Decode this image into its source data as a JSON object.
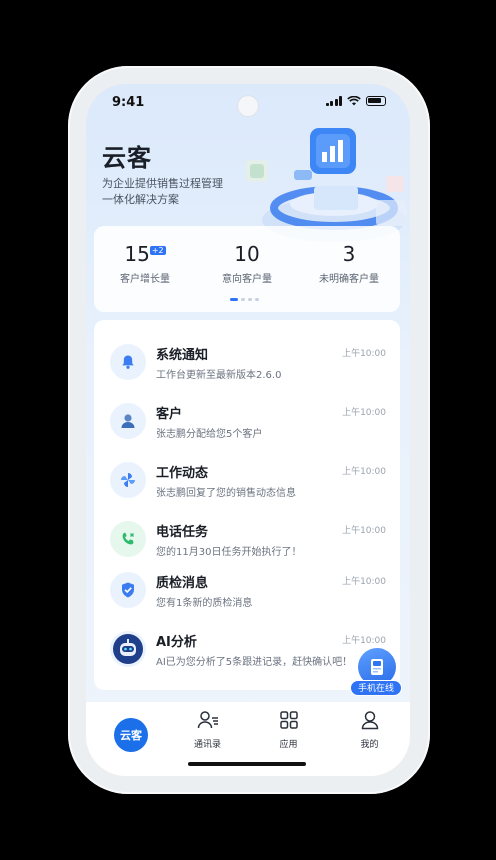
{
  "status_bar": {
    "time": "9:41"
  },
  "header": {
    "title": "云客",
    "subtitle_line1": "为企业提供销售过程管理",
    "subtitle_line2": "一体化解决方案"
  },
  "stats": [
    {
      "value": "15",
      "badge": "+2",
      "label": "客户增长量"
    },
    {
      "value": "10",
      "badge": "",
      "label": "意向客户量"
    },
    {
      "value": "3",
      "badge": "",
      "label": "未明确客户量"
    }
  ],
  "carousel": {
    "page_count": 4,
    "active_index": 0
  },
  "messages": [
    {
      "icon": "bell-icon",
      "title": "系统通知",
      "desc": "工作台更新至最新版本2.6.0",
      "time": "上午10:00"
    },
    {
      "icon": "user-icon",
      "title": "客户",
      "desc": "张志鹏分配给您5个客户",
      "time": "上午10:00"
    },
    {
      "icon": "pinwheel-icon",
      "title": "工作动态",
      "desc": "张志鹏回复了您的销售动态信息",
      "time": "上午10:00"
    },
    {
      "icon": "phone-icon",
      "title": "电话任务",
      "desc": "您的11月30日任务开始执行了！",
      "time": "上午10:00"
    },
    {
      "icon": "shield-check-icon",
      "title": "质检消息",
      "desc": "您有1条新的质检消息",
      "time": "上午10:00"
    },
    {
      "icon": "robot-icon",
      "title": "AI分析",
      "desc": "AI已为您分析了5条跟进记录，赶快确认吧！",
      "time": "上午10:00"
    }
  ],
  "fab": {
    "label": "手机在线",
    "icon": "phone-card-icon"
  },
  "tabbar": {
    "home": "云客",
    "contacts": "通讯录",
    "apps": "应用",
    "me": "我的"
  },
  "colors": {
    "primary": "#2f74f5",
    "tab_home": "#1b6fe8",
    "phone_green": "#2dba6a"
  }
}
